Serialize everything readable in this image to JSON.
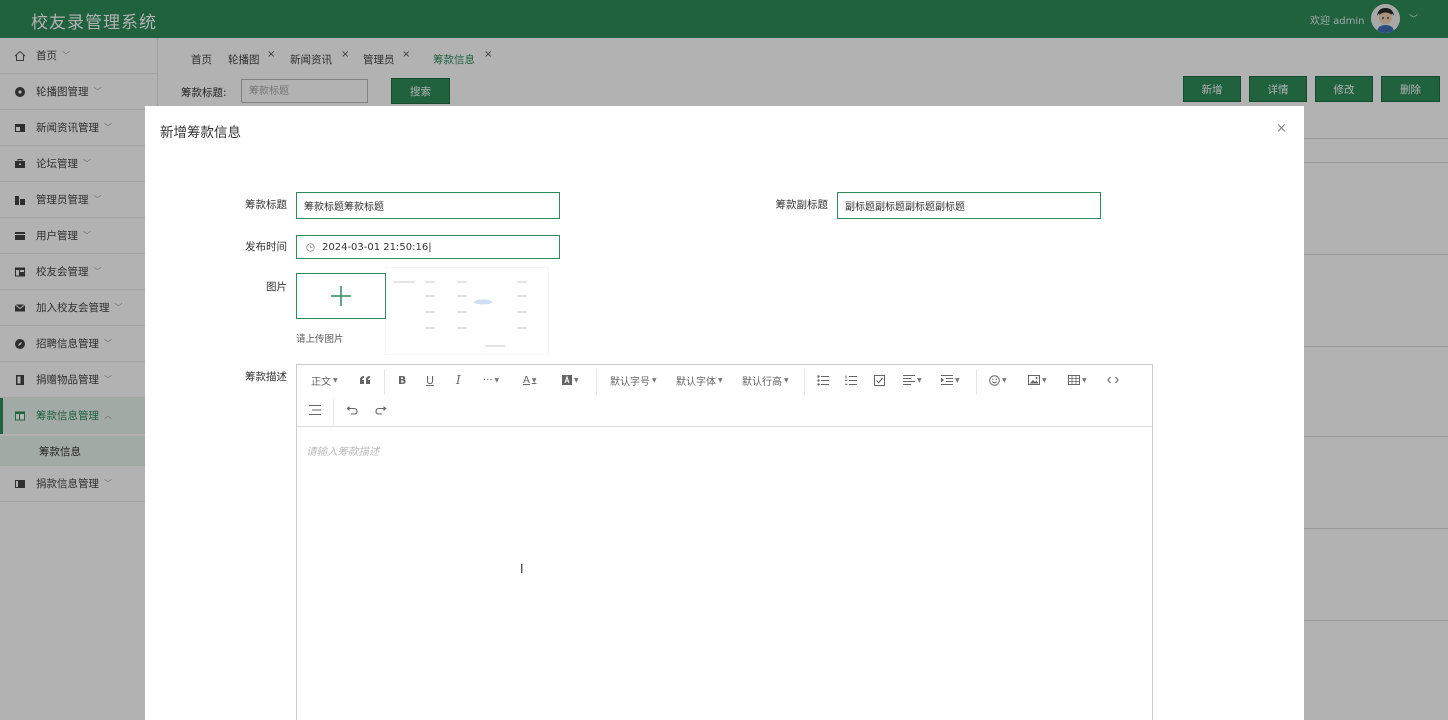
{
  "header": {
    "title": "校友录管理系统",
    "welcome": "欢迎 admin"
  },
  "sidebar": {
    "items": [
      {
        "label": "首页",
        "icon": "home-icon"
      },
      {
        "label": "轮播图管理",
        "icon": "disc-icon"
      },
      {
        "label": "新闻资讯管理",
        "icon": "news-icon"
      },
      {
        "label": "论坛管理",
        "icon": "forum-icon"
      },
      {
        "label": "管理员管理",
        "icon": "admin-icon"
      },
      {
        "label": "用户管理",
        "icon": "user-icon"
      },
      {
        "label": "校友会管理",
        "icon": "association-icon"
      },
      {
        "label": "加入校友会管理",
        "icon": "mail-icon"
      },
      {
        "label": "招聘信息管理",
        "icon": "compass-icon"
      },
      {
        "label": "捐赠物品管理",
        "icon": "book-icon"
      },
      {
        "label": "筹款信息管理",
        "icon": "table-icon"
      },
      {
        "label": "捐款信息管理",
        "icon": "donation-icon"
      }
    ],
    "sub_item": "筹款信息"
  },
  "tabs": [
    {
      "label": "首页"
    },
    {
      "label": "轮播图"
    },
    {
      "label": "新闻资讯"
    },
    {
      "label": "管理员"
    },
    {
      "label": "筹款信息"
    }
  ],
  "search": {
    "label": "筹款标题:",
    "placeholder": "筹款标题",
    "button": "搜索"
  },
  "actions": {
    "add": "新增",
    "detail": "详情",
    "edit": "修改",
    "delete": "删除"
  },
  "modal": {
    "title": "新增筹款信息",
    "close": "×",
    "fields": {
      "title_label": "筹款标题",
      "title_value": "筹款标题筹款标题",
      "subtitle_label": "筹款副标题",
      "subtitle_value": "副标题副标题副标题副标题",
      "time_label": "发布时间",
      "time_value": "2024-03-01 21:50:16",
      "image_label": "图片",
      "upload_hint": "请上传图片",
      "desc_label": "筹款描述"
    },
    "editor": {
      "paragraph": "正文",
      "font_size": "默认字号",
      "font_family": "默认字体",
      "line_height": "默认行高",
      "more": "···",
      "placeholder": "请输入筹款描述"
    }
  },
  "colors": {
    "primary": "#2e8b5a"
  }
}
